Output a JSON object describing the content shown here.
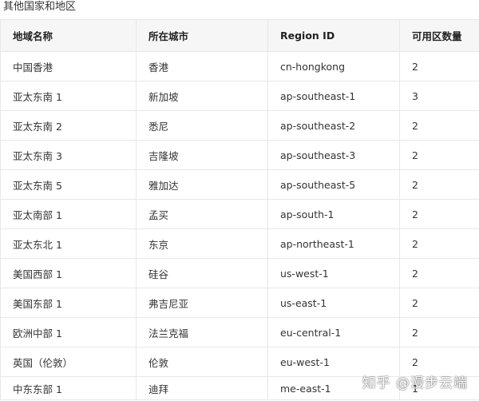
{
  "section": {
    "title": "其他国家和地区"
  },
  "table": {
    "headers": [
      "地域名称",
      "所在城市",
      "Region ID",
      "可用区数量"
    ],
    "rows": [
      [
        "中国香港",
        "香港",
        "cn-hongkong",
        "2"
      ],
      [
        "亚太东南 1",
        "新加坡",
        "ap-southeast-1",
        "3"
      ],
      [
        "亚太东南 2",
        "悉尼",
        "ap-southeast-2",
        "2"
      ],
      [
        "亚太东南 3",
        "吉隆坡",
        "ap-southeast-3",
        "2"
      ],
      [
        "亚太东南 5",
        "雅加达",
        "ap-southeast-5",
        "2"
      ],
      [
        "亚太南部 1",
        "孟买",
        "ap-south-1",
        "2"
      ],
      [
        "亚太东北 1",
        "东京",
        "ap-northeast-1",
        "2"
      ],
      [
        "美国西部 1",
        "硅谷",
        "us-west-1",
        "2"
      ],
      [
        "美国东部 1",
        "弗吉尼亚",
        "us-east-1",
        "2"
      ],
      [
        "欧洲中部 1",
        "法兰克福",
        "eu-central-1",
        "2"
      ],
      [
        "英国（伦敦）",
        "伦敦",
        "eu-west-1",
        "2"
      ],
      [
        "中东东部 1",
        "迪拜",
        "me-east-1",
        "1"
      ]
    ]
  },
  "watermark": {
    "text": "知乎 @漫步云端"
  }
}
